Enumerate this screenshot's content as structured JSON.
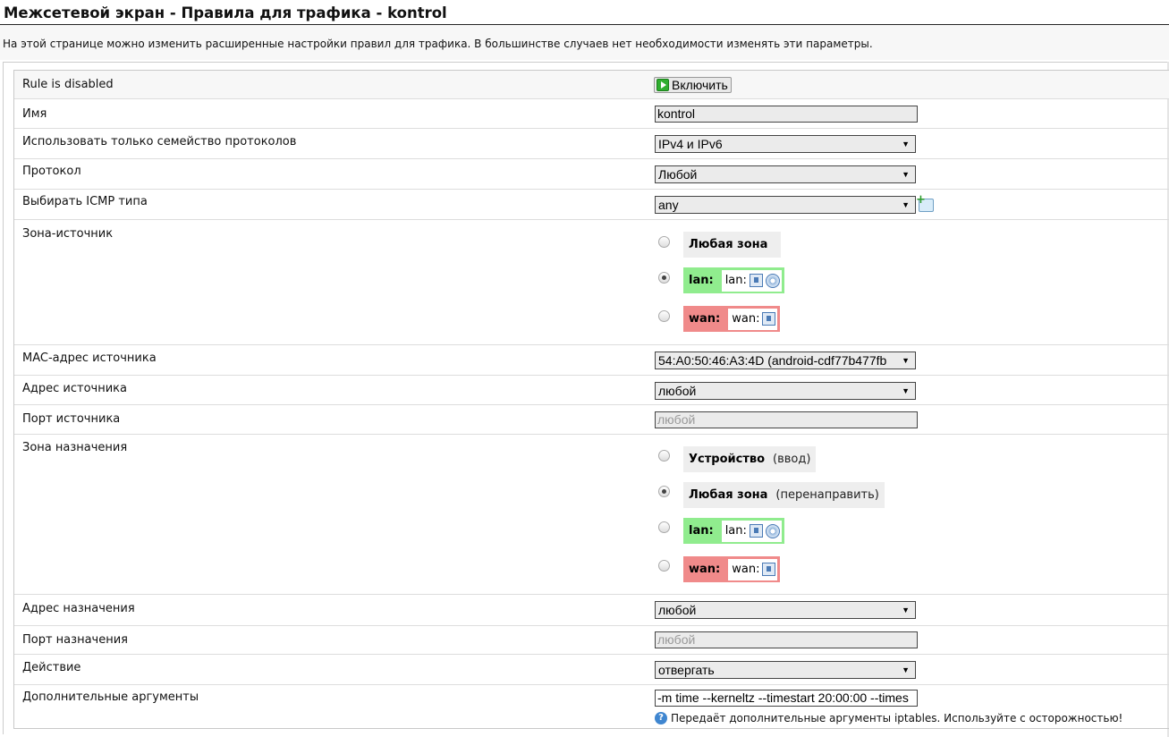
{
  "header": {
    "title": "Межсетевой экран - Правила для трафика - kontrol",
    "description": "На этой странице можно изменить расширенные настройки правил для трафика. В большинстве случаев нет необходимости изменять эти параметры."
  },
  "form": {
    "rule_status": {
      "label": "Rule is disabled",
      "button_label": "Включить"
    },
    "name": {
      "label": "Имя",
      "value": "kontrol"
    },
    "family": {
      "label": "Использовать только семейство протоколов",
      "value": "IPv4 и IPv6"
    },
    "protocol": {
      "label": "Протокол",
      "value": "Любой"
    },
    "icmp": {
      "label": "Выбирать ICMP типа",
      "value": "any"
    },
    "src_zone": {
      "label": "Зона-источник",
      "any_label": "Любая зона",
      "lan_label": "lan:",
      "lan_iface": "lan:",
      "wan_label": "wan:",
      "wan_iface": "wan:",
      "selected": "lan"
    },
    "src_mac": {
      "label": "MAC-адрес источника",
      "value": "54:A0:50:46:A3:4D (android-cdf77b477fb"
    },
    "src_ip": {
      "label": "Адрес источника",
      "value": "любой"
    },
    "src_port": {
      "label": "Порт источника",
      "placeholder": "любой"
    },
    "dest_zone": {
      "label": "Зона назначения",
      "device_label": "Устройство",
      "device_note": "(ввод)",
      "any_label": "Любая зона",
      "any_note": "(перенаправить)",
      "lan_label": "lan:",
      "lan_iface": "lan:",
      "wan_label": "wan:",
      "wan_iface": "wan:",
      "selected": "any"
    },
    "dest_ip": {
      "label": "Адрес назначения",
      "value": "любой"
    },
    "dest_port": {
      "label": "Порт назначения",
      "placeholder": "любой"
    },
    "action": {
      "label": "Действие",
      "value": "отвергать"
    },
    "extra": {
      "label": "Дополнительные аргументы",
      "value": "-m time --kerneltz --timestart 20:00:00 --times",
      "help": "Передаёт дополнительные аргументы iptables. Используйте с осторожностью!"
    }
  },
  "colors": {
    "lan_zone": "#90ec8e",
    "wan_zone": "#f08a8a",
    "any_zone": "#eeeeee"
  },
  "icons": [
    "play-icon",
    "add-icon",
    "ethernet-icon",
    "wifi-icon",
    "help-icon",
    "chevron-down-icon"
  ]
}
